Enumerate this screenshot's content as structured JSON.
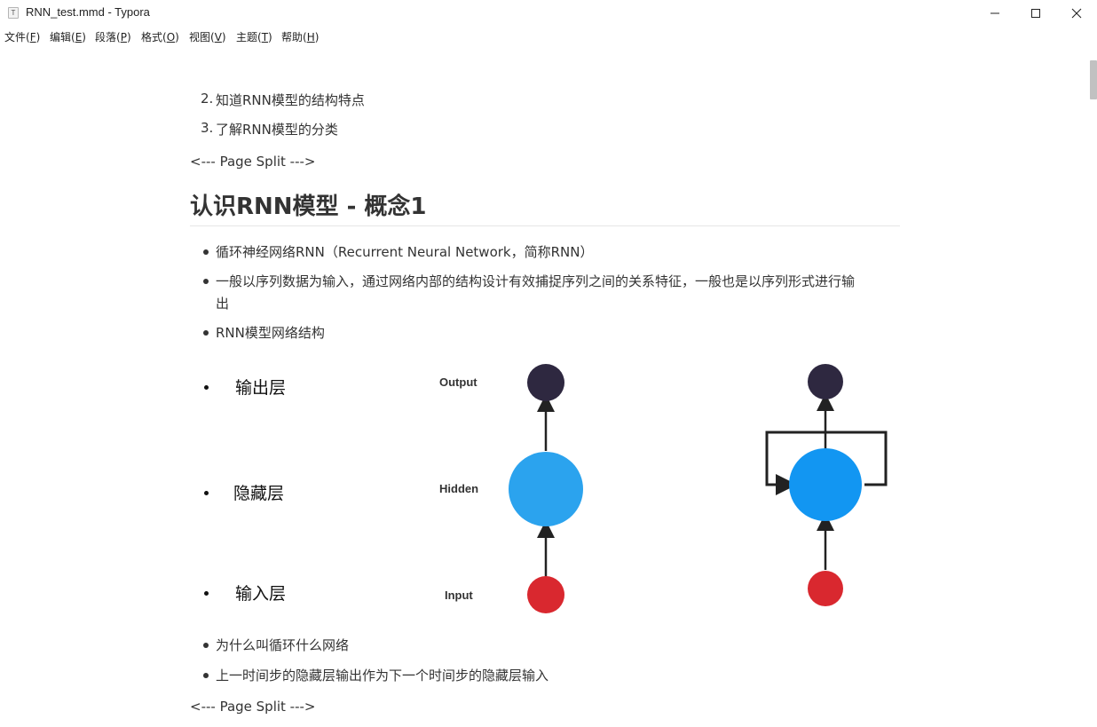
{
  "window": {
    "title": "RNN_test.mmd - Typora",
    "app_icon_glyph": "T"
  },
  "menu": {
    "items": [
      {
        "label": "文件(",
        "acc": "F",
        "tail": ")"
      },
      {
        "label": "编辑(",
        "acc": "E",
        "tail": ")"
      },
      {
        "label": "段落(",
        "acc": "P",
        "tail": ")"
      },
      {
        "label": "格式(",
        "acc": "O",
        "tail": ")"
      },
      {
        "label": "视图(",
        "acc": "V",
        "tail": ")"
      },
      {
        "label": "主题(",
        "acc": "T",
        "tail": ")"
      },
      {
        "label": "帮助(",
        "acc": "H",
        "tail": ")"
      }
    ]
  },
  "doc": {
    "ordered_list": [
      {
        "num": "2.",
        "text": "知道RNN模型的结构特点"
      },
      {
        "num": "3.",
        "text": "了解RNN模型的分类"
      }
    ],
    "page_split_1": "<--- Page Split --->",
    "heading": "认识RNN模型 - 概念1",
    "bullets_1": [
      "循环神经网络RNN（Recurrent Neural Network，简称RNN）",
      "一般以序列数据为输入，通过网络内部的结构设计有效捕捉序列之间的关系特征，一般也是以序列形式进行输",
      "出",
      "RNN模型网络结构"
    ],
    "figure": {
      "layers": [
        "输出层",
        "隐藏层",
        "输入层"
      ],
      "labels": {
        "output": "Output",
        "hidden": "Hidden",
        "input": "Input"
      },
      "colors": {
        "output_node": "#2e2840",
        "hidden_node": "#2ba3ee",
        "input_node": "#d9282f",
        "arrow": "#222222"
      }
    },
    "bullets_2": [
      "为什么叫循环什么网络",
      "上一时间步的隐藏层输出作为下一个时间步的隐藏层输入"
    ],
    "page_split_2": "<--- Page Split --->"
  }
}
